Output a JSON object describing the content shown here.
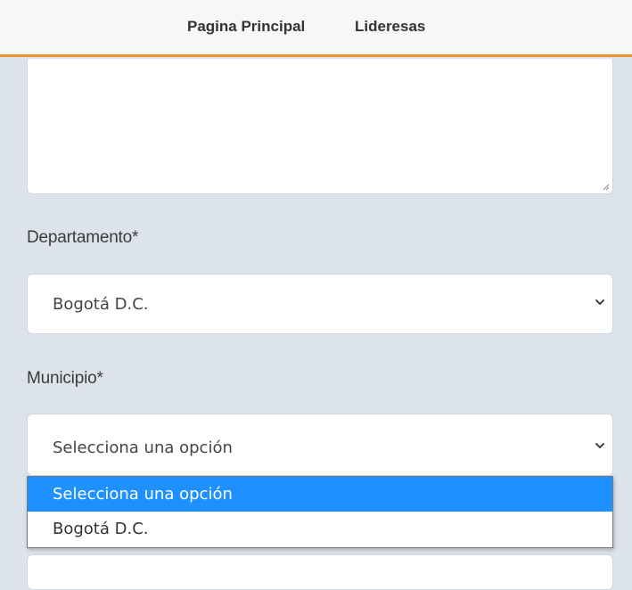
{
  "nav": {
    "home": "Pagina Principal",
    "leaders": "Lideresas"
  },
  "form": {
    "departamento": {
      "label": "Departamento*",
      "value": "Bogotá D.C."
    },
    "municipio": {
      "label": "Municipio*",
      "value": "Selecciona una opción",
      "options": [
        "Selecciona una opción",
        "Bogotá D.C."
      ],
      "highlighted_option": "Selecciona una opción"
    }
  },
  "colors": {
    "accent": "#e8912d",
    "highlight": "#1e90ff",
    "page_background": "#dde3ea"
  },
  "icons": {
    "select_chevron": "chevron-down-icon",
    "textarea_resize": "resize-grip-icon"
  }
}
